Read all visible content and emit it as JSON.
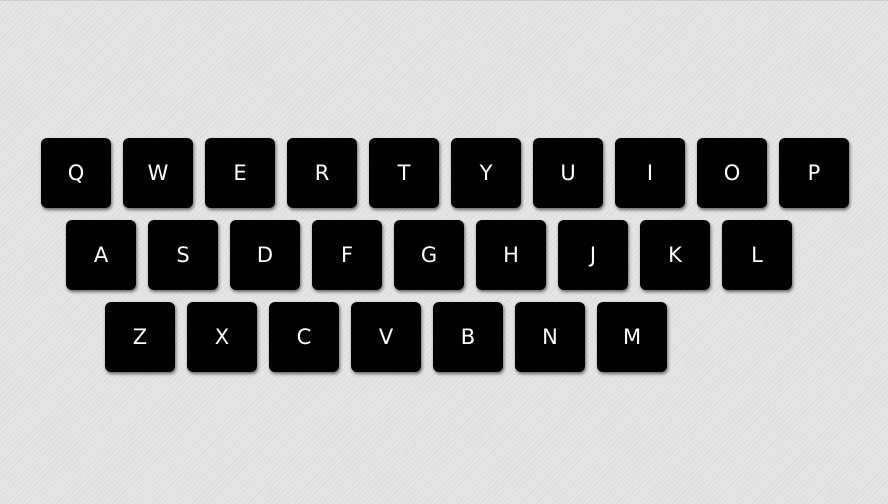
{
  "keyboard": {
    "rows": [
      [
        "Q",
        "W",
        "E",
        "R",
        "T",
        "Y",
        "U",
        "I",
        "O",
        "P"
      ],
      [
        "A",
        "S",
        "D",
        "F",
        "G",
        "H",
        "J",
        "K",
        "L"
      ],
      [
        "Z",
        "X",
        "C",
        "V",
        "B",
        "N",
        "M"
      ]
    ]
  },
  "colors": {
    "key_background": "#020202",
    "key_text": "#ffffff",
    "page_background": "#e3e3e3"
  }
}
